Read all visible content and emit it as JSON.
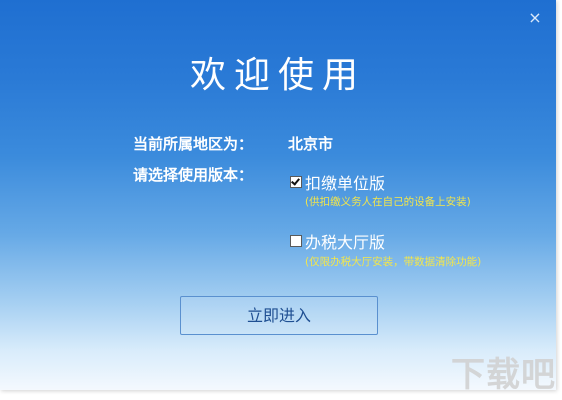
{
  "dialog": {
    "title": "欢迎使用",
    "close_glyph": "×"
  },
  "region": {
    "label": "当前所属地区为：",
    "value": "北京市"
  },
  "version": {
    "label": "请选择使用版本：",
    "options": [
      {
        "label": "扣缴单位版",
        "hint": "(供扣缴义务人在自己的设备上安装)",
        "checked": true
      },
      {
        "label": "办税大厅版",
        "hint": "(仅限办税大厅安装，带数据清除功能)",
        "checked": false
      }
    ]
  },
  "actions": {
    "enter_label": "立即进入"
  },
  "watermark": {
    "text": "下载吧"
  },
  "colors": {
    "hint": "#f3e64b",
    "button_text": "#1f4f92",
    "gradient_top": "#1f6fd1",
    "gradient_bottom": "#f4f9fe"
  }
}
